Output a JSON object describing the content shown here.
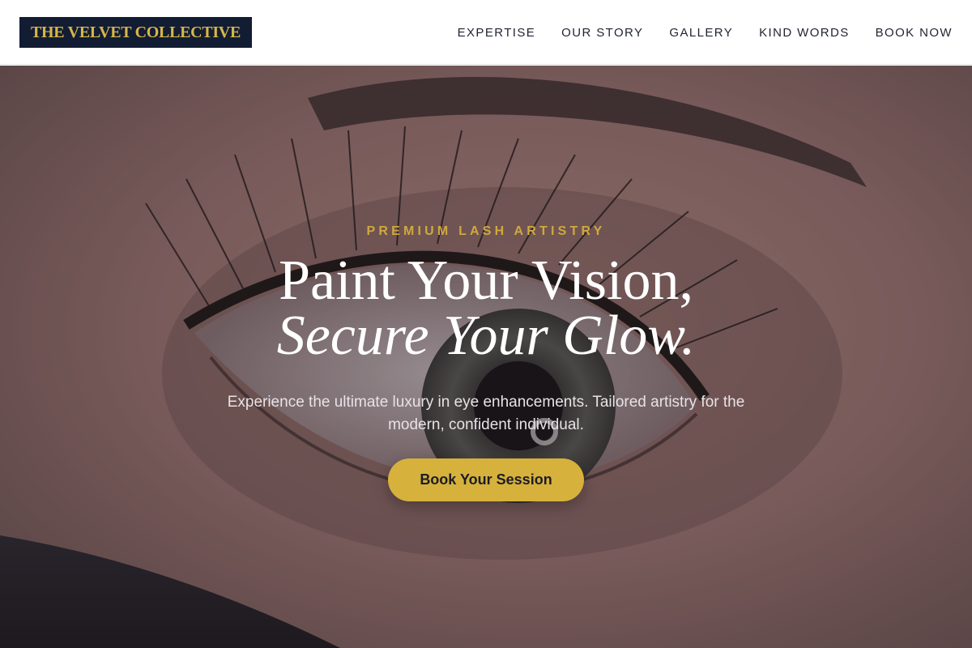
{
  "header": {
    "logo_text": "THE VELVET COLLECTIVE",
    "nav": [
      {
        "label": "EXPERTISE"
      },
      {
        "label": "OUR STORY"
      },
      {
        "label": "GALLERY"
      },
      {
        "label": "KIND WORDS"
      },
      {
        "label": "BOOK NOW"
      }
    ]
  },
  "hero": {
    "eyebrow": "PREMIUM LASH ARTISTRY",
    "headline_line1": "Paint Your Vision,",
    "headline_line2": "Secure Your Glow.",
    "subtitle": "Experience the ultimate luxury in eye enhancements. Tailored artistry for the modern, confident individual.",
    "cta_label": "Book Your Session",
    "background_image": "close-up-eye-with-lash-extensions"
  },
  "colors": {
    "logo_background": "#121d33",
    "logo_text": "#d8b64a",
    "accent_gold": "#d6b13c",
    "nav_text": "#1f2430",
    "headline_text": "#ffffff"
  }
}
